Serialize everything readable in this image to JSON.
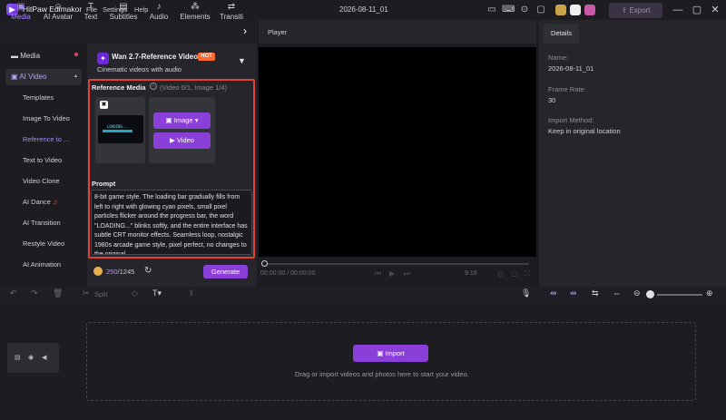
{
  "app": {
    "name": "HitPaw Edimakor",
    "menu": [
      "File",
      "Settings",
      "Help"
    ],
    "project_name": "2026-08-11_01",
    "export_label": "Export"
  },
  "top_tabs": [
    {
      "label": "Media",
      "icon": "media-icon"
    },
    {
      "label": "AI Avatar",
      "icon": "avatar-icon"
    },
    {
      "label": "Text",
      "icon": "text-icon"
    },
    {
      "label": "Subtitles",
      "icon": "subtitles-icon"
    },
    {
      "label": "Audio",
      "icon": "music-icon"
    },
    {
      "label": "Elements",
      "icon": "elements-icon"
    },
    {
      "label": "Transiti",
      "icon": "transition-icon"
    }
  ],
  "sidebar": {
    "groups": [
      {
        "label": "Media"
      },
      {
        "label": "AI Video"
      }
    ],
    "items": [
      "Templates",
      "Image To Video",
      "Reference to ...",
      "Text to Video",
      "Video Clone",
      "AI Dance",
      "AI Transition",
      "Restyle Video",
      "AI Animation"
    ]
  },
  "model": {
    "name": "Wan 2.7-Reference Video",
    "badge": "HOT",
    "subtitle": "Cinematic videos with audio"
  },
  "reference": {
    "label": "Reference Media",
    "counts": "(Video 0/1, Image 1/4)",
    "thumb_text": "LOADING...",
    "image_button": "Image",
    "video_button": "Video"
  },
  "prompt": {
    "label": "Prompt",
    "text": "8-bit game style. The loading bar gradually fills from left to right with glowing cyan pixels, small pixel particles flicker around the progress bar, the word \"LOADING...\" blinks softly, and the entire interface has subtle CRT monitor effects. Seamless loop, nostalgic 1980s arcade game style, pixel perfect, no changes to the original"
  },
  "credits": {
    "used": "250",
    "total": "/1245",
    "generate_label": "Generate"
  },
  "player": {
    "title": "Player",
    "timecode": "00:00:00 / 00:00:00",
    "aspect": "9:16"
  },
  "details": {
    "tab": "Details",
    "fields": [
      {
        "key": "Name:",
        "value": "2026-08-11_01"
      },
      {
        "key": "Frame Rate:",
        "value": "30"
      },
      {
        "key": "Import Method:",
        "value": "Keep in original location"
      }
    ]
  },
  "timeline": {
    "split_label": "Split",
    "import_label": "Import",
    "drop_text": "Drag or import videos and photos here to start your video."
  },
  "colors": {
    "accent": "#8b3fd9",
    "highlight": "#e04432",
    "hot_badge": "#ff6a2c"
  }
}
